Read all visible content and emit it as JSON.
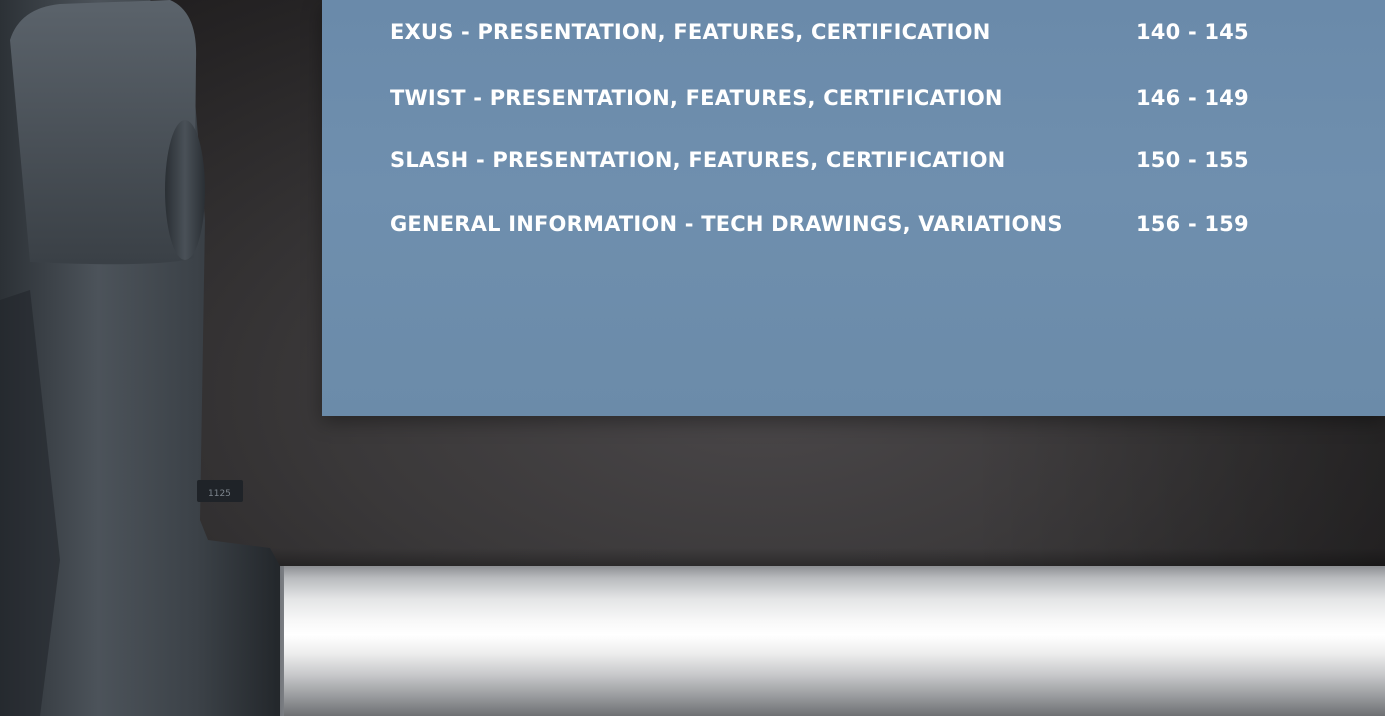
{
  "toc": {
    "rows": [
      {
        "title": "EXUS - PRESENTATION, FEATURES, CERTIFICATION",
        "pages": "140 - 145"
      },
      {
        "title": "TWIST - PRESENTATION, FEATURES, CERTIFICATION",
        "pages": "146 - 149"
      },
      {
        "title": "SLASH - PRESENTATION, FEATURES, CERTIFICATION",
        "pages": "150 - 155"
      },
      {
        "title": "GENERAL INFORMATION - TECH DRAWINGS, VARIATIONS",
        "pages": "156 - 159"
      }
    ]
  },
  "photo": {
    "handle_label": "1125"
  },
  "colors": {
    "panel": "#6b8bab",
    "text": "#ffffff",
    "background": "#3a3839",
    "handle": "#3d4349"
  }
}
